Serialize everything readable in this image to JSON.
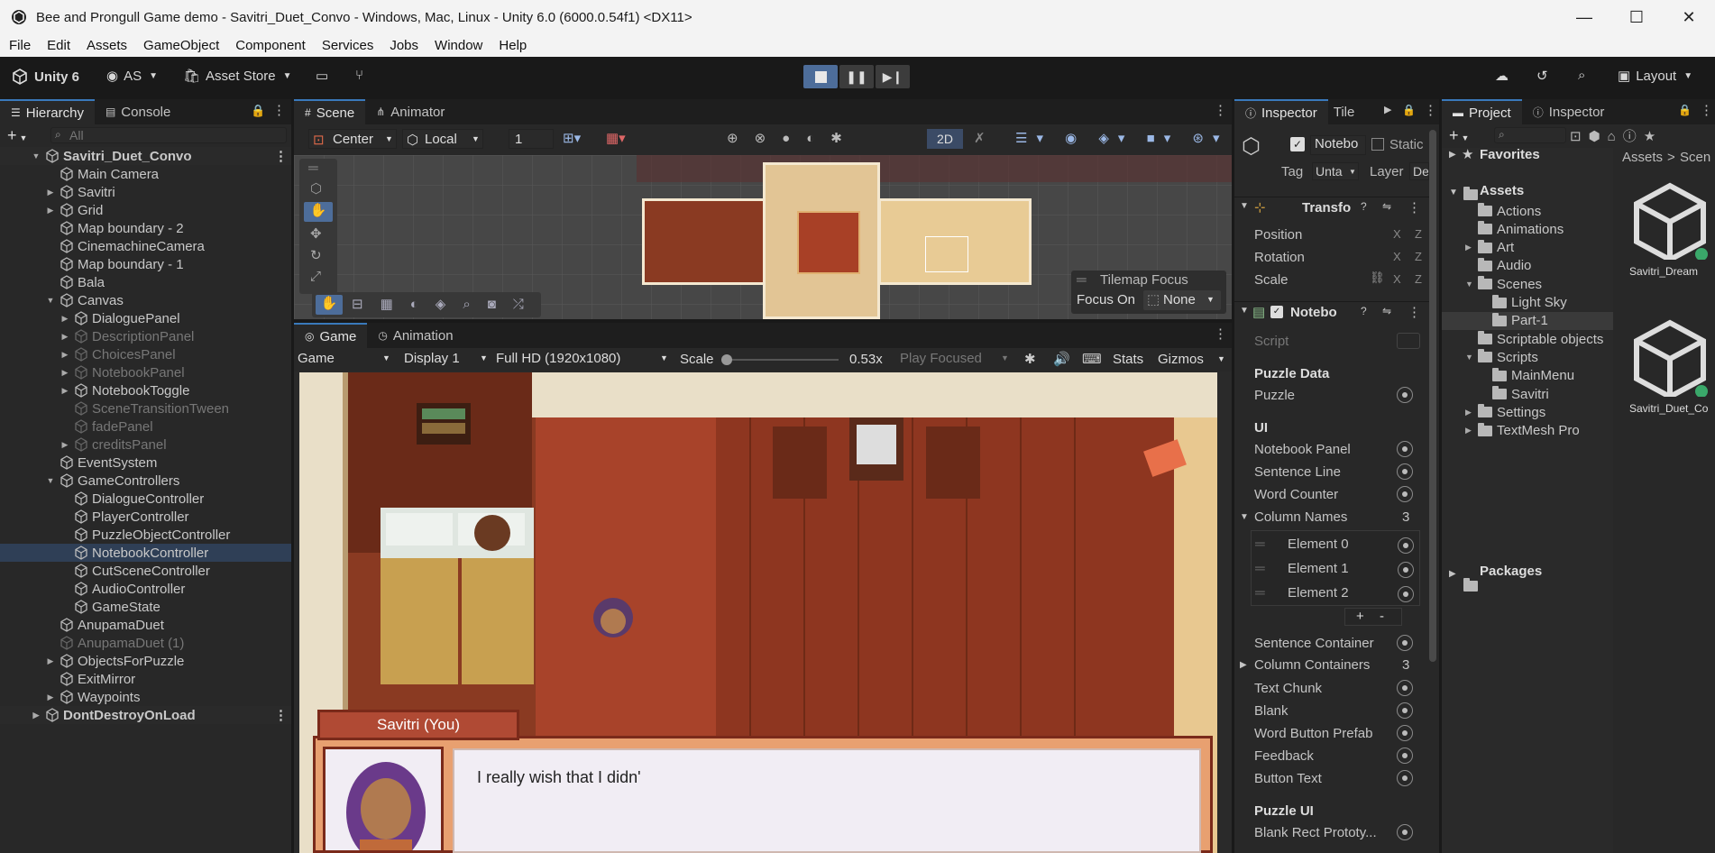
{
  "window": {
    "title": "Bee and Prongull Game demo - Savitri_Duet_Convo - Windows, Mac, Linux - Unity 6.0 (6000.0.54f1) <DX11>",
    "minimize": "—",
    "maximize": "☐",
    "close": "✕"
  },
  "menu": [
    "File",
    "Edit",
    "Assets",
    "GameObject",
    "Component",
    "Services",
    "Jobs",
    "Window",
    "Help"
  ],
  "toolbar": {
    "unity_label": "Unity 6",
    "account": "AS",
    "asset_store": "Asset Store",
    "layout": "Layout"
  },
  "hierarchy": {
    "tab": "Hierarchy",
    "console_tab": "Console",
    "search_placeholder": "All",
    "scene": "Savitri_Duet_Convo",
    "items": [
      {
        "label": "Main Camera",
        "indent": 1,
        "arrow": ""
      },
      {
        "label": "Savitri",
        "indent": 1,
        "arrow": "▶"
      },
      {
        "label": "Grid",
        "indent": 1,
        "arrow": "▶"
      },
      {
        "label": "Map boundary - 2",
        "indent": 1,
        "arrow": ""
      },
      {
        "label": "CinemachineCamera",
        "indent": 1,
        "arrow": ""
      },
      {
        "label": "Map boundary - 1",
        "indent": 1,
        "arrow": ""
      },
      {
        "label": "Bala",
        "indent": 1,
        "arrow": ""
      },
      {
        "label": "Canvas",
        "indent": 1,
        "arrow": "▼"
      },
      {
        "label": "DialoguePanel",
        "indent": 2,
        "arrow": "▶"
      },
      {
        "label": "DescriptionPanel",
        "indent": 2,
        "arrow": "▶",
        "dim": true
      },
      {
        "label": "ChoicesPanel",
        "indent": 2,
        "arrow": "▶",
        "dim": true
      },
      {
        "label": "NotebookPanel",
        "indent": 2,
        "arrow": "▶",
        "dim": true
      },
      {
        "label": "NotebookToggle",
        "indent": 2,
        "arrow": "▶"
      },
      {
        "label": "SceneTransitionTween",
        "indent": 2,
        "arrow": "",
        "dim": true
      },
      {
        "label": "fadePanel",
        "indent": 2,
        "arrow": "",
        "dim": true
      },
      {
        "label": "creditsPanel",
        "indent": 2,
        "arrow": "▶",
        "dim": true
      },
      {
        "label": "EventSystem",
        "indent": 1,
        "arrow": ""
      },
      {
        "label": "GameControllers",
        "indent": 1,
        "arrow": "▼"
      },
      {
        "label": "DialogueController",
        "indent": 2,
        "arrow": ""
      },
      {
        "label": "PlayerController",
        "indent": 2,
        "arrow": ""
      },
      {
        "label": "PuzzleObjectController",
        "indent": 2,
        "arrow": ""
      },
      {
        "label": "NotebookController",
        "indent": 2,
        "arrow": "",
        "sel": true
      },
      {
        "label": "CutSceneController",
        "indent": 2,
        "arrow": ""
      },
      {
        "label": "AudioController",
        "indent": 2,
        "arrow": ""
      },
      {
        "label": "GameState",
        "indent": 2,
        "arrow": ""
      },
      {
        "label": "AnupamaDuet",
        "indent": 1,
        "arrow": ""
      },
      {
        "label": "AnupamaDuet (1)",
        "indent": 1,
        "arrow": "",
        "dim": true
      },
      {
        "label": "ObjectsForPuzzle",
        "indent": 1,
        "arrow": "▶"
      },
      {
        "label": "ExitMirror",
        "indent": 1,
        "arrow": ""
      },
      {
        "label": "Waypoints",
        "indent": 1,
        "arrow": "▶"
      }
    ],
    "dontdestroy": "DontDestroyOnLoad"
  },
  "scene": {
    "tab": "Scene",
    "animator_tab": "Animator",
    "pivot": "Center",
    "space": "Local",
    "grid_value": "1",
    "mode_2d": "2D",
    "tilemap_title": "Tilemap Focus",
    "focus_label": "Focus On",
    "focus_value": "None"
  },
  "game": {
    "tab": "Game",
    "animation_tab": "Animation",
    "display_mode": "Game",
    "display": "Display 1",
    "resolution": "Full HD (1920x1080)",
    "scale_label": "Scale",
    "scale_value": "0.53x",
    "play_mode": "Play Focused",
    "stats": "Stats",
    "gizmos": "Gizmos",
    "speaker": "Savitri (You)",
    "dialogue": "I really wish that I didn'"
  },
  "inspector": {
    "tab": "Inspector",
    "tile_tab": "Tile",
    "object_name": "Notebo",
    "static_label": "Static",
    "tag_label": "Tag",
    "tag_value": "Unta",
    "layer_label": "Layer",
    "layer_value": "De",
    "transform_title": "Transfo",
    "position": "Position",
    "rotation": "Rotation",
    "scale": "Scale",
    "notebook_title": "Notebo",
    "script_label": "Script",
    "puzzle_data": "Puzzle Data",
    "puzzle": "Puzzle",
    "ui_header": "UI",
    "notebook_panel": "Notebook Panel",
    "sentence_line": "Sentence Line",
    "word_counter": "Word Counter",
    "column_names": "Column Names",
    "column_names_count": "3",
    "elements": [
      "Element 0",
      "Element 1",
      "Element 2"
    ],
    "plus": "+",
    "minus": "-",
    "sentence_container": "Sentence Container",
    "column_containers": "Column Containers",
    "column_containers_count": "3",
    "text_chunk": "Text Chunk",
    "blank": "Blank",
    "word_button_prefab": "Word Button Prefab",
    "feedback": "Feedback",
    "button_text": "Button Text",
    "puzzle_ui": "Puzzle UI",
    "blank_rect": "Blank Rect Prototy..."
  },
  "project": {
    "tab": "Project",
    "inspector_tab": "Inspector",
    "favorites": "Favorites",
    "assets": "Assets",
    "folders": [
      {
        "label": "Actions",
        "indent": 1
      },
      {
        "label": "Animations",
        "indent": 1
      },
      {
        "label": "Art",
        "indent": 1,
        "arrow": "▶"
      },
      {
        "label": "Audio",
        "indent": 1
      },
      {
        "label": "Scenes",
        "indent": 1,
        "arrow": "▼"
      },
      {
        "label": "Light Sky",
        "indent": 2
      },
      {
        "label": "Part-1",
        "indent": 2,
        "sel": true
      },
      {
        "label": "Scriptable objects",
        "indent": 1
      },
      {
        "label": "Scripts",
        "indent": 1,
        "arrow": "▼"
      },
      {
        "label": "MainMenu",
        "indent": 2
      },
      {
        "label": "Savitri",
        "indent": 2
      },
      {
        "label": "Settings",
        "indent": 1,
        "arrow": "▶"
      },
      {
        "label": "TextMesh Pro",
        "indent": 1,
        "arrow": "▶"
      }
    ],
    "packages": "Packages",
    "breadcrumb_assets": "Assets",
    "breadcrumb_next": "Scen",
    "grid_items": [
      "Savitri_Dream",
      "Savitri_Duet_Co"
    ]
  }
}
